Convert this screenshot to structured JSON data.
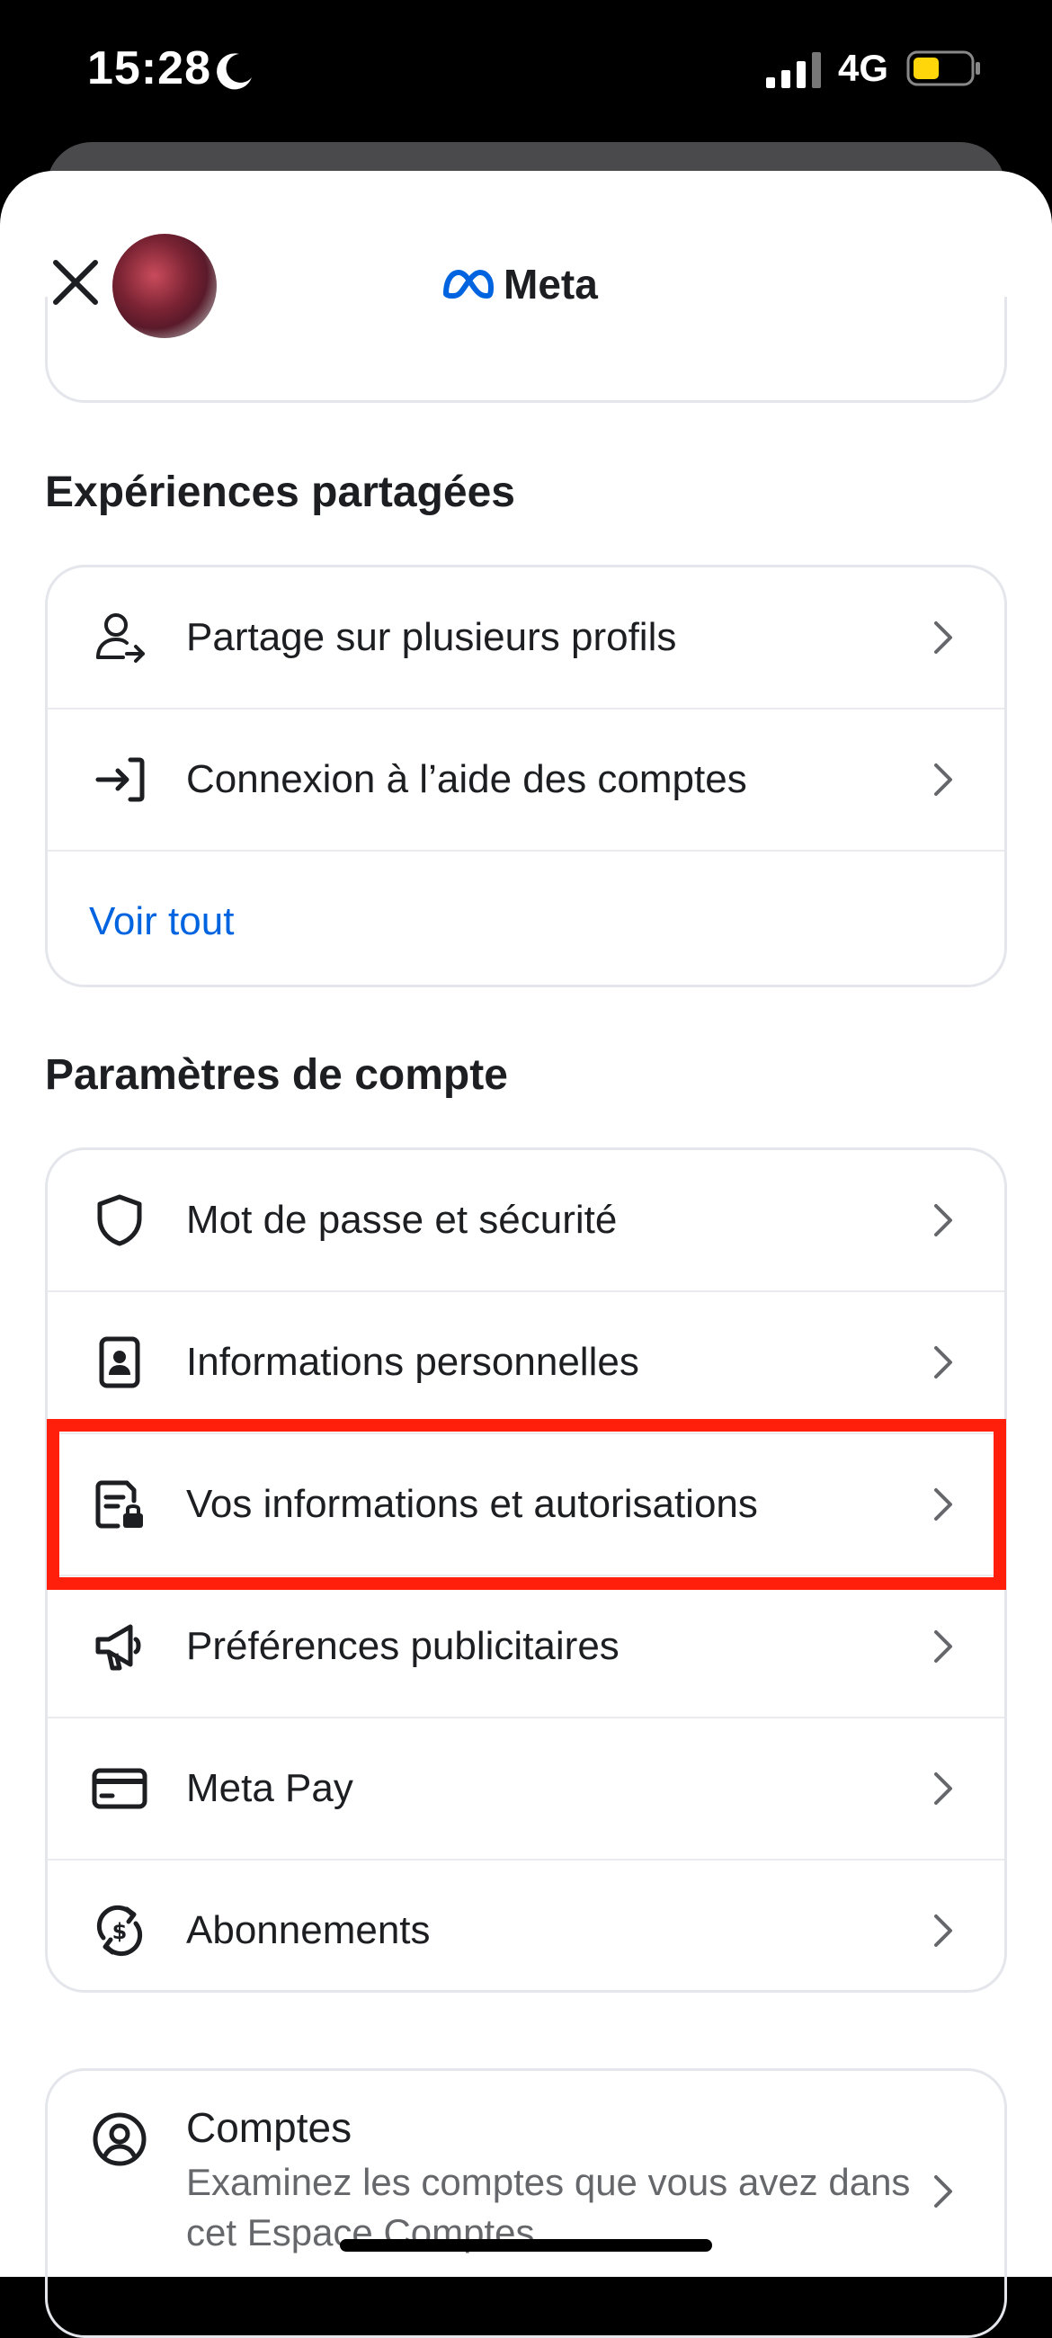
{
  "status_bar": {
    "time": "15:28",
    "network": "4G",
    "battery_color": "#ffd60a"
  },
  "header": {
    "brand": "Meta",
    "close_icon": "close-icon",
    "brand_color": "#0064e0"
  },
  "shared_experiences": {
    "title": "Expériences partagées",
    "items": [
      {
        "label": "Partage sur plusieurs profils",
        "icon": "profile-share-icon"
      },
      {
        "label": "Connexion à l’aide des comptes",
        "icon": "login-arrow-icon"
      }
    ],
    "see_all": "Voir tout"
  },
  "account_settings": {
    "title": "Paramètres de compte",
    "items": [
      {
        "label": "Mot de passe et sécurité",
        "icon": "shield-icon"
      },
      {
        "label": "Informations personnelles",
        "icon": "id-card-icon"
      },
      {
        "label": "Vos informations et autorisations",
        "icon": "document-lock-icon"
      },
      {
        "label": "Préférences publicitaires",
        "icon": "megaphone-icon"
      },
      {
        "label": "Meta Pay",
        "icon": "credit-card-icon"
      },
      {
        "label": "Abonnements",
        "icon": "subscription-dollar-icon"
      }
    ]
  },
  "accounts": {
    "title": "Comptes",
    "subtitle": "Examinez les comptes que vous avez dans cet Espace Comptes",
    "icon": "user-circle-icon"
  },
  "colors": {
    "link": "#0064e0",
    "highlight": "#ff1f0a",
    "text": "#1c1e21",
    "secondary": "#65676b"
  }
}
